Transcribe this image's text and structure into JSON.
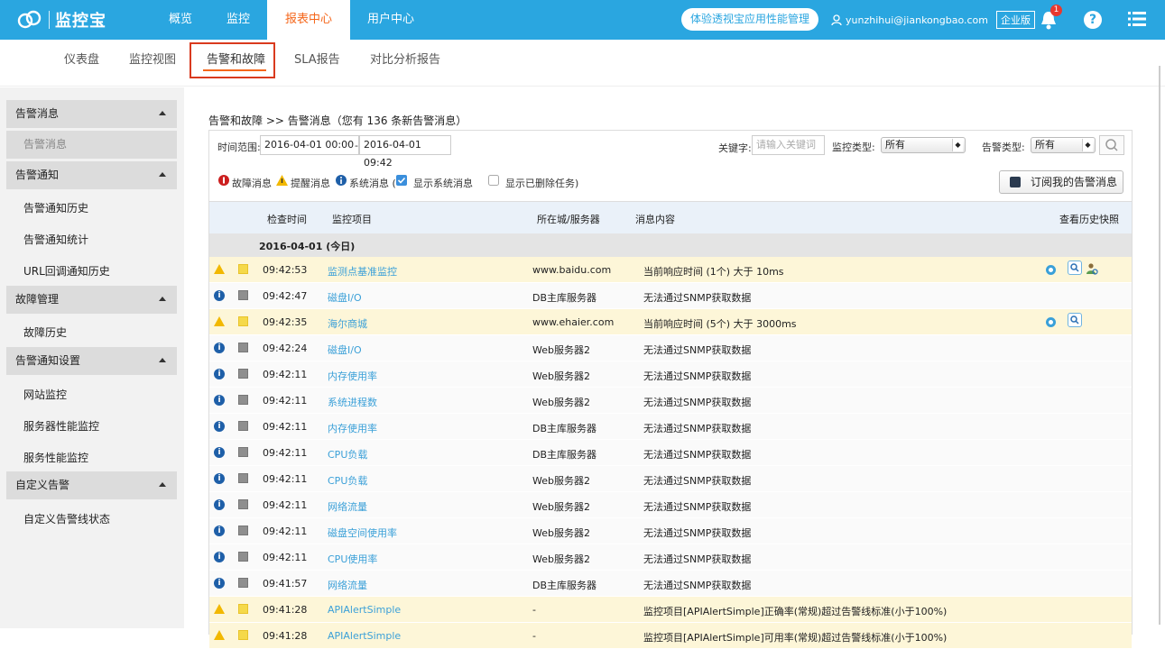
{
  "app": {
    "logo_text": "监控宝"
  },
  "main_nav": [
    {
      "label": "概览"
    },
    {
      "label": "监控"
    },
    {
      "label": "报表中心"
    },
    {
      "label": "用户中心"
    }
  ],
  "header": {
    "trial_label": "体验透视宝应用性能管理",
    "user_email": "yunzhihui@jiankongbao.com",
    "edition": "企业版",
    "notification_count": "1",
    "help_label": "?"
  },
  "sub_nav": [
    {
      "label": "仪表盘"
    },
    {
      "label": "监控视图"
    },
    {
      "label": "告警和故障"
    },
    {
      "label": "SLA报告"
    },
    {
      "label": "对比分析报告"
    }
  ],
  "sidebar": {
    "groups": [
      {
        "label": "告警消息",
        "items": [
          "告警消息"
        ]
      },
      {
        "label": "告警通知",
        "items": [
          "告警通知历史",
          "告警通知统计",
          "URL回调通知历史"
        ]
      },
      {
        "label": "故障管理",
        "items": [
          "故障历史"
        ]
      },
      {
        "label": "告警通知设置",
        "items": [
          "网站监控",
          "服务器性能监控",
          "服务性能监控"
        ]
      },
      {
        "label": "自定义告警",
        "items": [
          "自定义告警线状态"
        ]
      }
    ]
  },
  "breadcrumb": "告警和故障 >> 告警消息（您有 136 条新告警消息）",
  "filters": {
    "time_label": "时间范围:",
    "time_from": "2016-04-01 00:00",
    "time_sep": "-",
    "time_to": "2016-04-01 09:42",
    "keyword_label": "关键字:",
    "keyword_placeholder": "请输入关键词",
    "monitor_type_label": "监控类型:",
    "monitor_type_value": "所有",
    "alert_type_label": "告警类型:",
    "alert_type_value": "所有"
  },
  "legend": {
    "fault": "故障消息",
    "reminder": "提醒消息",
    "system": "系统消息 (",
    "show_system": "显示系统消息",
    "show_deleted": "显示已删除任务)"
  },
  "subscribe_label": "订阅我的告警消息",
  "table": {
    "headers": {
      "time": "检查时间",
      "item": "监控项目",
      "host": "所在城/服务器",
      "message": "消息内容",
      "snapshot": "查看历史快照"
    },
    "date_group": "2016-04-01 (今日)",
    "rows": [
      {
        "type": "warn",
        "time": "09:42:53",
        "item": "监测点基准监控",
        "host": "www.baidu.com",
        "message": "当前响应时间 (1个) 大于 10ms",
        "snap": "full"
      },
      {
        "type": "info",
        "time": "09:42:47",
        "item": "磁盘I/O",
        "host": "DB主库服务器",
        "message": "无法通过SNMP获取数据",
        "snap": ""
      },
      {
        "type": "warn",
        "time": "09:42:35",
        "item": "海尔商城",
        "host": "www.ehaier.com",
        "message": "当前响应时间 (5个) 大于 3000ms",
        "snap": "partial"
      },
      {
        "type": "info",
        "time": "09:42:24",
        "item": "磁盘I/O",
        "host": "Web服务器2",
        "message": "无法通过SNMP获取数据",
        "snap": ""
      },
      {
        "type": "info",
        "time": "09:42:11",
        "item": "内存使用率",
        "host": "Web服务器2",
        "message": "无法通过SNMP获取数据",
        "snap": ""
      },
      {
        "type": "info",
        "time": "09:42:11",
        "item": "系统进程数",
        "host": "Web服务器2",
        "message": "无法通过SNMP获取数据",
        "snap": ""
      },
      {
        "type": "info",
        "time": "09:42:11",
        "item": "内存使用率",
        "host": "DB主库服务器",
        "message": "无法通过SNMP获取数据",
        "snap": ""
      },
      {
        "type": "info",
        "time": "09:42:11",
        "item": "CPU负载",
        "host": "DB主库服务器",
        "message": "无法通过SNMP获取数据",
        "snap": ""
      },
      {
        "type": "info",
        "time": "09:42:11",
        "item": "CPU负载",
        "host": "Web服务器2",
        "message": "无法通过SNMP获取数据",
        "snap": ""
      },
      {
        "type": "info",
        "time": "09:42:11",
        "item": "网络流量",
        "host": "Web服务器2",
        "message": "无法通过SNMP获取数据",
        "snap": ""
      },
      {
        "type": "info",
        "time": "09:42:11",
        "item": "磁盘空间使用率",
        "host": "Web服务器2",
        "message": "无法通过SNMP获取数据",
        "snap": ""
      },
      {
        "type": "info",
        "time": "09:42:11",
        "item": "CPU使用率",
        "host": "Web服务器2",
        "message": "无法通过SNMP获取数据",
        "snap": ""
      },
      {
        "type": "info",
        "time": "09:41:57",
        "item": "网络流量",
        "host": "DB主库服务器",
        "message": "无法通过SNMP获取数据",
        "snap": ""
      },
      {
        "type": "warn",
        "time": "09:41:28",
        "item": "APIAlertSimple",
        "host": "-",
        "message": "监控项目[APIAlertSimple]正确率(常规)超过告警线标准(小于100%)",
        "snap": ""
      },
      {
        "type": "warn",
        "time": "09:41:28",
        "item": "APIAlertSimple",
        "host": "-",
        "message": "监控项目[APIAlertSimple]可用率(常规)超过告警线标准(小于100%)",
        "snap": ""
      }
    ]
  },
  "colors": {
    "topbar": "#2aa6e0",
    "accent_orange": "#f5661a",
    "link_blue": "#3ba0d8",
    "warn_row": "#fdf6d8",
    "badge_red": "#e8382f"
  }
}
